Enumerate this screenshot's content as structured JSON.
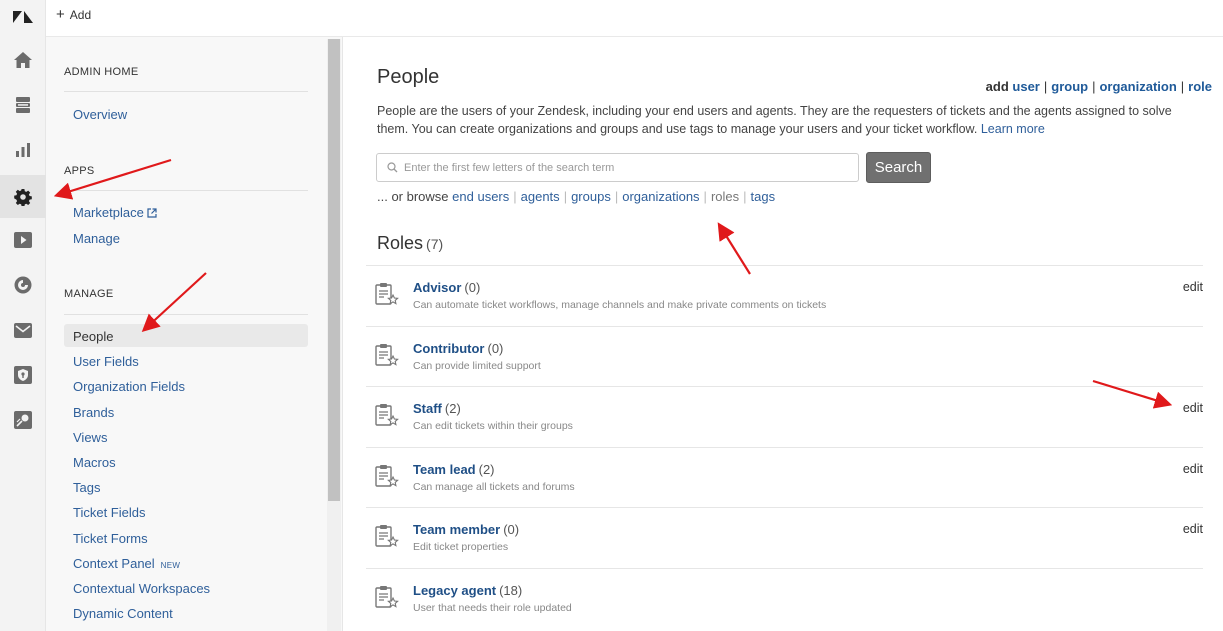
{
  "topbar": {
    "add_label": "Add"
  },
  "rail": {
    "items": [
      {
        "icon": "zendesk-logo-icon"
      },
      {
        "icon": "home-icon"
      },
      {
        "icon": "views-icon"
      },
      {
        "icon": "reporting-icon"
      },
      {
        "icon": "gear-icon",
        "active": true
      },
      {
        "icon": "video-icon"
      },
      {
        "icon": "explore-icon"
      },
      {
        "icon": "mail-icon"
      },
      {
        "icon": "shield-icon"
      },
      {
        "icon": "apps-icon"
      }
    ]
  },
  "sidebar": {
    "admin_home": {
      "label": "ADMIN HOME",
      "items": [
        {
          "label": "Overview"
        }
      ]
    },
    "apps": {
      "label": "APPS",
      "items": [
        {
          "label": "Marketplace"
        },
        {
          "label": "Manage"
        }
      ]
    },
    "manage": {
      "label": "MANAGE",
      "items": [
        {
          "label": "People",
          "active": true
        },
        {
          "label": "User Fields"
        },
        {
          "label": "Organization Fields"
        },
        {
          "label": "Brands"
        },
        {
          "label": "Views"
        },
        {
          "label": "Macros"
        },
        {
          "label": "Tags"
        },
        {
          "label": "Ticket Fields"
        },
        {
          "label": "Ticket Forms"
        },
        {
          "label": "Context Panel",
          "badge": "NEW"
        },
        {
          "label": "Contextual Workspaces"
        },
        {
          "label": "Dynamic Content"
        }
      ]
    }
  },
  "main": {
    "title": "People",
    "add_links": {
      "prefix": "add",
      "user": "user",
      "group": "group",
      "organization": "organization",
      "role": "role"
    },
    "description": "People are the users of your Zendesk, including your end users and agents. They are the requesters of tickets and the agents assigned to solve them. You can create organizations and groups and use tags to manage your users and your ticket workflow.",
    "learn_more": "Learn more",
    "search": {
      "placeholder": "Enter the first few letters of the search term",
      "value": "",
      "button": "Search"
    },
    "browse": {
      "prefix": "... or browse",
      "links": [
        "end users",
        "agents",
        "groups",
        "organizations",
        "roles",
        "tags"
      ],
      "current": "roles"
    },
    "roles_title": "Roles",
    "roles_count": "(7)",
    "roles": [
      {
        "name": "Advisor",
        "count": "(0)",
        "description": "Can automate ticket workflows, manage channels and make private comments on tickets",
        "edit": "edit"
      },
      {
        "name": "Contributor",
        "count": "(0)",
        "description": "Can provide limited support",
        "edit": ""
      },
      {
        "name": "Staff",
        "count": "(2)",
        "description": "Can edit tickets within their groups",
        "edit": "edit"
      },
      {
        "name": "Team lead",
        "count": "(2)",
        "description": "Can manage all tickets and forums",
        "edit": "edit"
      },
      {
        "name": "Team member",
        "count": "(0)",
        "description": "Edit ticket properties",
        "edit": "edit"
      },
      {
        "name": "Legacy agent",
        "count": "(18)",
        "description": "User that needs their role updated",
        "edit": ""
      }
    ]
  },
  "colors": {
    "link": "#2f5f9a",
    "annotation_arrow": "#e0191b",
    "search_button": "#707070"
  }
}
